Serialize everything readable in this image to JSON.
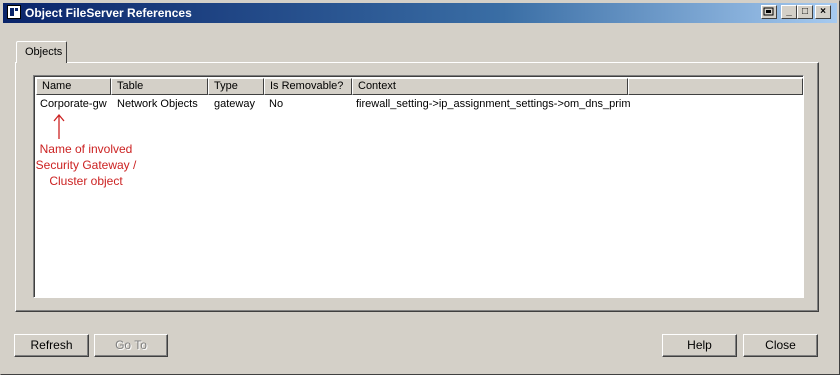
{
  "window": {
    "title": "Object FileServer References"
  },
  "tabs": [
    {
      "label": "Objects"
    }
  ],
  "table": {
    "columns": [
      "Name",
      "Table",
      "Type",
      "Is Removable?",
      "Context"
    ],
    "rows": [
      [
        "Corporate-gw",
        "Network Objects",
        "gateway",
        "No",
        "firewall_setting->ip_assignment_settings->om_dns_prim"
      ]
    ]
  },
  "annotation": {
    "lines": [
      "Name of involved",
      "Security Gateway /",
      "Cluster object"
    ],
    "color": "#cc2222"
  },
  "buttons": {
    "refresh": "Refresh",
    "goto": "Go To",
    "help": "Help",
    "close": "Close"
  },
  "titlebar_buttons": {
    "minimize": "_",
    "maximize": "□",
    "close": "×"
  },
  "colors": {
    "titlebar": "#0a246a",
    "face": "#d4d0c8"
  }
}
